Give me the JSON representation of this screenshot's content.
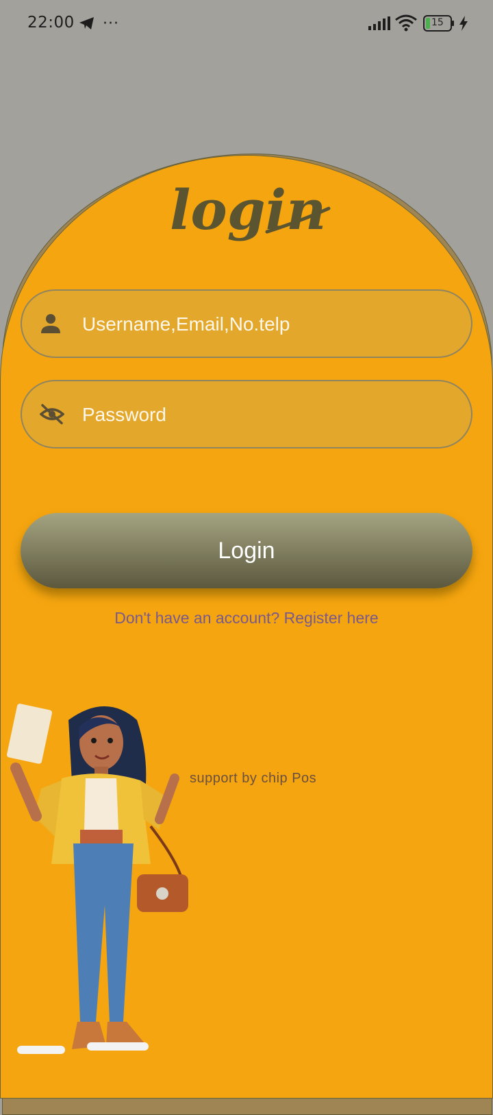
{
  "status_bar": {
    "time": "22:00",
    "more_indicator": "···",
    "battery_level": "15",
    "icons": [
      "telegram-icon",
      "signal-icon",
      "wifi-icon",
      "battery-icon",
      "charging-bolt-icon"
    ]
  },
  "logo_text": "login",
  "username_field": {
    "placeholder": "Username,Email,No.telp",
    "value": "",
    "icon": "person-icon"
  },
  "password_field": {
    "placeholder": "Password",
    "value": "",
    "icon": "eye-off-icon"
  },
  "login_button_label": "Login",
  "register_link_text": "Don't have an account? Register here",
  "support_text": "support by chip Pos",
  "colors": {
    "background": "#a3a19b",
    "arch": "#f5a50f",
    "field": "#e3a72b",
    "button_top": "#a5a481",
    "button_bottom": "#5b583e",
    "logo": "#5a5530",
    "link": "#7a5a8a"
  }
}
